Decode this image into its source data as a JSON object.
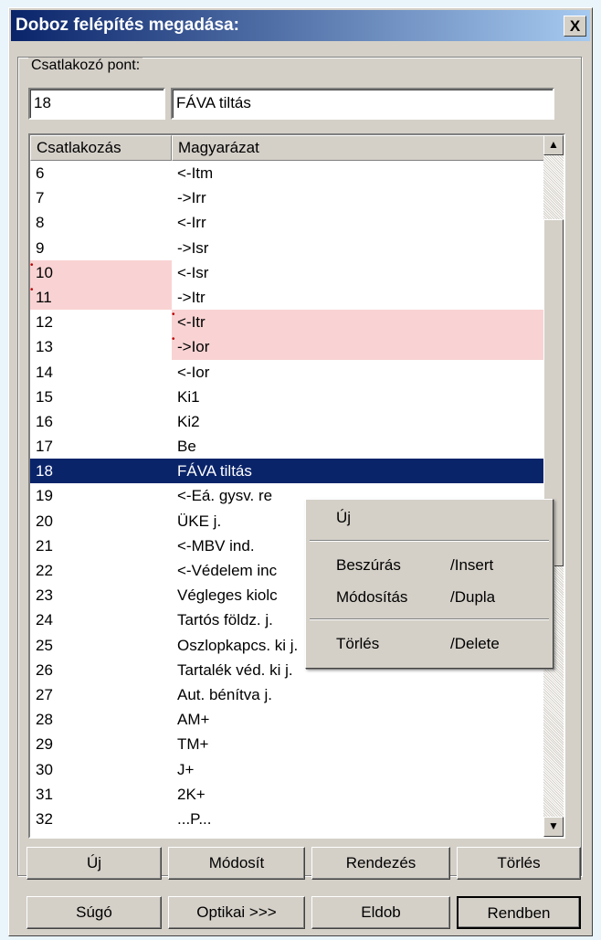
{
  "window": {
    "title": "Doboz felépítés megadása:",
    "close_glyph": "X"
  },
  "group": {
    "label": "Csatlakozó pont:"
  },
  "fields": {
    "number": "18",
    "description": "FÁVA tiltás"
  },
  "list": {
    "headers": [
      "Csatlakozás",
      "Magyarázat"
    ],
    "rows": [
      {
        "c": "6",
        "m": "<-Itm"
      },
      {
        "c": "7",
        "m": "->Irr"
      },
      {
        "c": "8",
        "m": "<-Irr"
      },
      {
        "c": "9",
        "m": "->Isr"
      },
      {
        "c": "10",
        "m": "<-Isr"
      },
      {
        "c": "11",
        "m": "->Itr"
      },
      {
        "c": "12",
        "m": "<-Itr"
      },
      {
        "c": "13",
        "m": "->Ior"
      },
      {
        "c": "14",
        "m": "<-Ior"
      },
      {
        "c": "15",
        "m": "Ki1"
      },
      {
        "c": "16",
        "m": "Ki2"
      },
      {
        "c": "17",
        "m": "Be"
      },
      {
        "c": "18",
        "m": "FÁVA tiltás"
      },
      {
        "c": "19",
        "m": "<-Eá. gysv. re"
      },
      {
        "c": "20",
        "m": "ÜKE j."
      },
      {
        "c": "21",
        "m": "<-MBV ind."
      },
      {
        "c": "22",
        "m": "<-Védelem inc"
      },
      {
        "c": "23",
        "m": "Végleges kiolc"
      },
      {
        "c": "24",
        "m": "Tartós földz. j."
      },
      {
        "c": "25",
        "m": "Oszlopkapcs. ki j."
      },
      {
        "c": "26",
        "m": "Tartalék véd. ki j."
      },
      {
        "c": "27",
        "m": "Aut. bénítva j."
      },
      {
        "c": "28",
        "m": "AM+"
      },
      {
        "c": "29",
        "m": "TM+"
      },
      {
        "c": "30",
        "m": "J+"
      },
      {
        "c": "31",
        "m": "2K+"
      },
      {
        "c": "32",
        "m": "...P..."
      }
    ],
    "selected_row": "18",
    "highlight_left_rows": [
      "10",
      "11"
    ],
    "highlight_right_rows": [
      "12",
      "13"
    ],
    "highlight_color": "#f9d3d3",
    "selection_color": "#0a246a"
  },
  "context_menu": {
    "new": "Új",
    "insert": "Beszúrás",
    "insert_shortcut": "/Insert",
    "modify": "Módosítás",
    "modify_shortcut": "/Dupla",
    "delete": "Törlés",
    "delete_shortcut": "/Delete"
  },
  "buttons_row1": {
    "new": "Új",
    "modify": "Módosít",
    "sort": "Rendezés",
    "delete": "Törlés"
  },
  "buttons_row2": {
    "help": "Súgó",
    "optical": "Optikai >>>",
    "discard": "Eldob",
    "ok": "Rendben"
  },
  "icons": {
    "scroll_up": "triangle-up-icon",
    "scroll_down": "triangle-down-icon",
    "close": "close-icon"
  }
}
